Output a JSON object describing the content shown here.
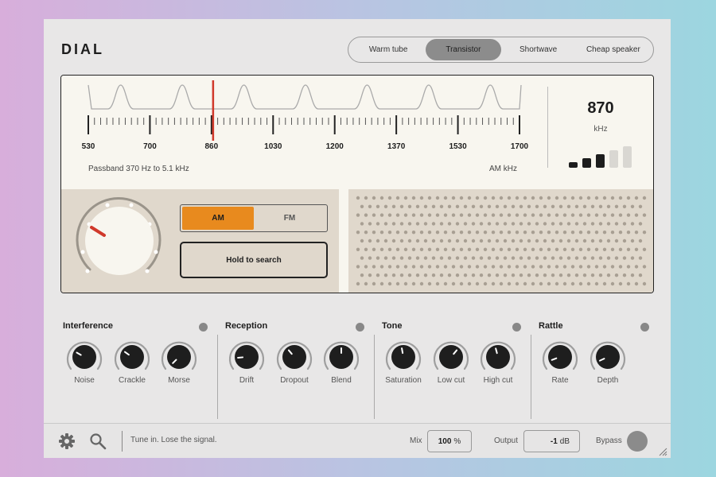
{
  "app": {
    "title": "DIAL"
  },
  "presets": [
    {
      "label": "Warm tube",
      "active": false
    },
    {
      "label": "Transistor",
      "active": true
    },
    {
      "label": "Shortwave",
      "active": false
    },
    {
      "label": "Cheap speaker",
      "active": false
    }
  ],
  "dial": {
    "scale_labels": [
      "530",
      "700",
      "860",
      "1030",
      "1200",
      "1370",
      "1530",
      "1700"
    ],
    "needle_value": 860,
    "passband_text": "Passband 370 Hz to 5.1 kHz",
    "band_unit_text": "AM  kHz",
    "frequency": "870",
    "frequency_unit": "kHz",
    "signal_bars_total": 5,
    "signal_bars_lit": 3
  },
  "band": {
    "options": [
      {
        "label": "AM",
        "active": true
      },
      {
        "label": "FM",
        "active": false
      }
    ]
  },
  "search_button": {
    "label": "Hold to search"
  },
  "sections": [
    {
      "title": "Interference",
      "knobs": [
        {
          "label": "Noise"
        },
        {
          "label": "Crackle"
        },
        {
          "label": "Morse"
        }
      ]
    },
    {
      "title": "Reception",
      "knobs": [
        {
          "label": "Drift"
        },
        {
          "label": "Dropout"
        },
        {
          "label": "Blend"
        }
      ]
    },
    {
      "title": "Tone",
      "knobs": [
        {
          "label": "Saturation"
        },
        {
          "label": "Low cut"
        },
        {
          "label": "High cut"
        }
      ]
    },
    {
      "title": "Rattle",
      "knobs": [
        {
          "label": "Rate"
        },
        {
          "label": "Depth"
        }
      ]
    }
  ],
  "footer": {
    "tagline": "Tune in. Lose the signal.",
    "mix_label": "Mix",
    "mix_value": "100",
    "mix_unit": "%",
    "output_label": "Output",
    "output_value": "-1",
    "output_unit": "dB",
    "bypass_label": "Bypass"
  },
  "icons": {
    "settings": "gear-icon",
    "search": "magnifier-icon",
    "resize": "resize-grip-icon"
  },
  "colors": {
    "accent": "#e88a1e",
    "needle": "#d0392b",
    "panel": "#e0d8cc",
    "display": "#f8f6ef"
  }
}
